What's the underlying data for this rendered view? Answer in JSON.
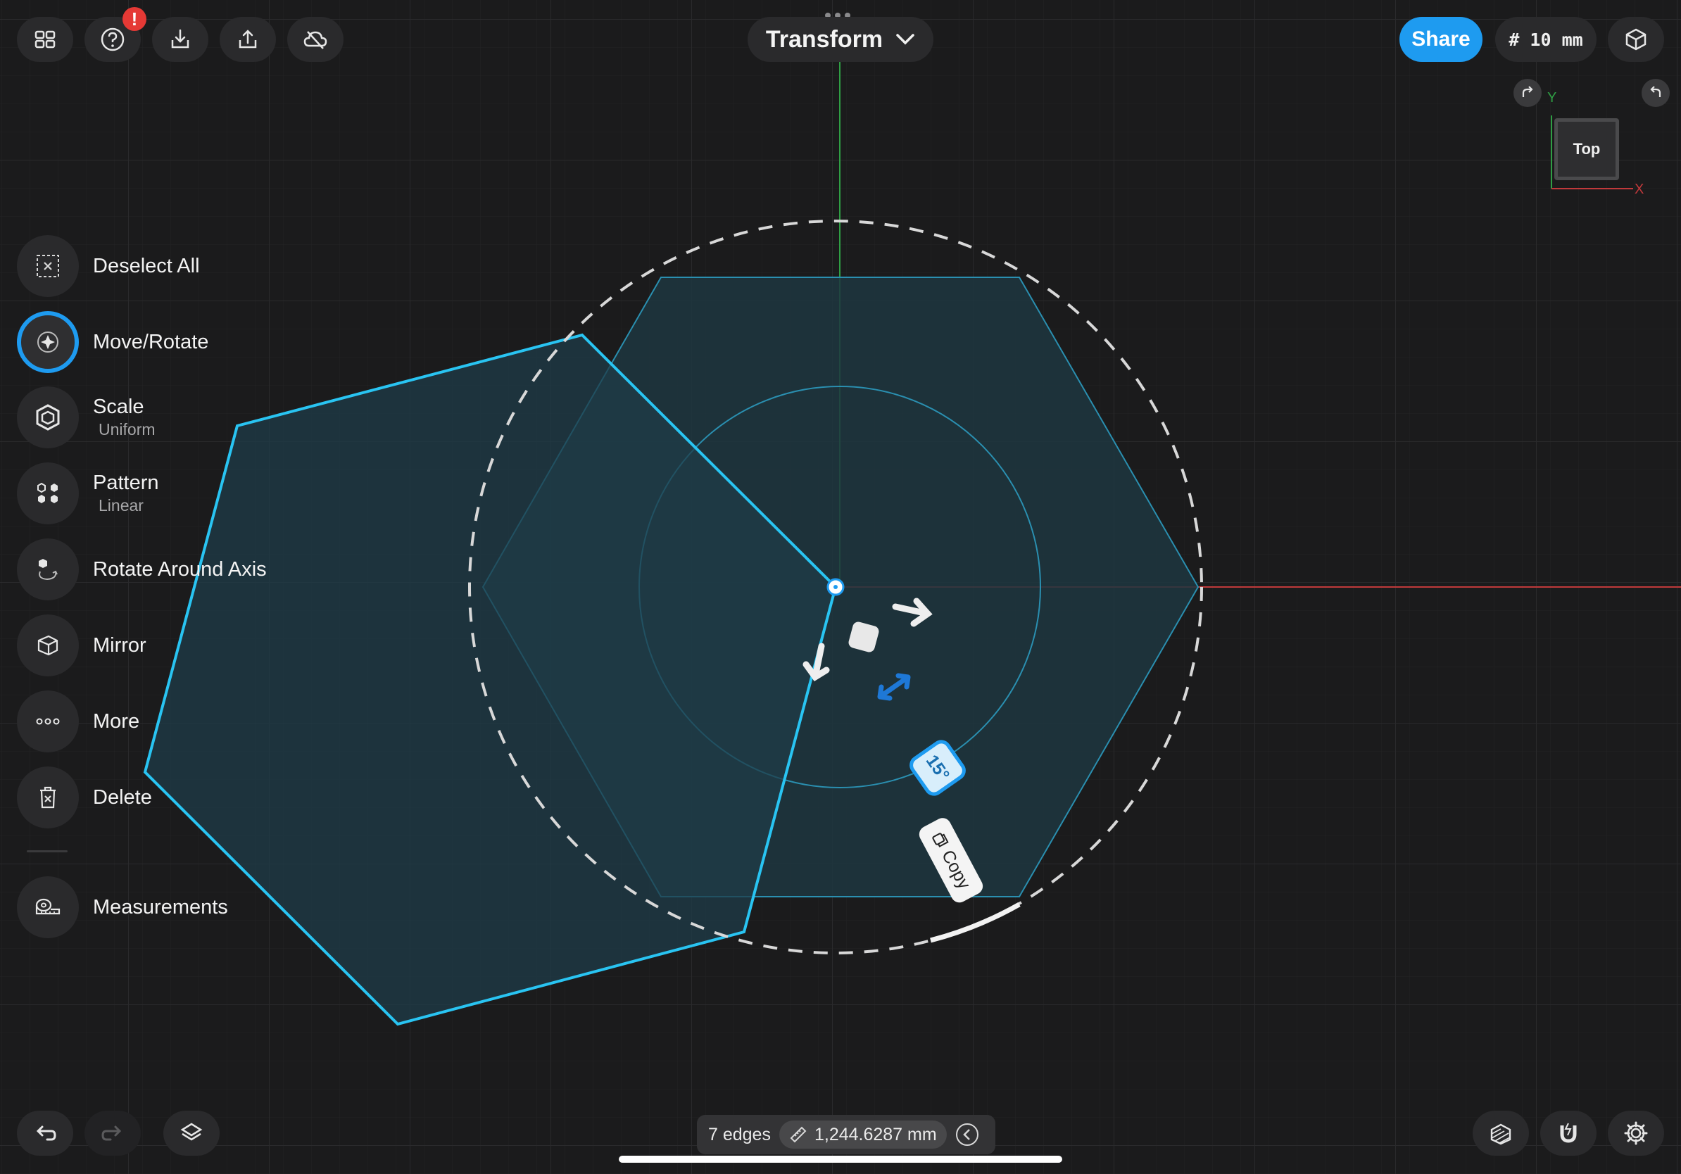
{
  "header": {
    "title": "Transform",
    "share_label": "Share",
    "grid_label": "# 10 mm",
    "notification_badge": "!"
  },
  "toolbar_icons": [
    "grid-icon",
    "help-icon",
    "import-icon",
    "export-icon",
    "cloud-off-icon"
  ],
  "tools": [
    {
      "label": "Deselect All",
      "sub": "",
      "icon": "deselect-icon"
    },
    {
      "label": "Move/Rotate",
      "sub": "",
      "icon": "move-rotate-icon",
      "active": true
    },
    {
      "label": "Scale",
      "sub": "Uniform",
      "icon": "scale-icon"
    },
    {
      "label": "Pattern",
      "sub": "Linear",
      "icon": "pattern-icon"
    },
    {
      "label": "Rotate Around Axis",
      "sub": "",
      "icon": "rotate-axis-icon"
    },
    {
      "label": "Mirror",
      "sub": "",
      "icon": "mirror-icon"
    },
    {
      "label": "More",
      "sub": "",
      "icon": "more-icon"
    },
    {
      "label": "Delete",
      "sub": "",
      "icon": "trash-icon"
    },
    {
      "label": "Measurements",
      "sub": "",
      "icon": "tape-measure-icon"
    }
  ],
  "viewcube": {
    "face_label": "Top",
    "axis_y": "Y",
    "axis_x": "X"
  },
  "canvas": {
    "angle_label": "15°",
    "copy_label": "Copy"
  },
  "status": {
    "edges": "7 edges",
    "length": "1,244.6287 mm"
  },
  "colors": {
    "accent": "#1e9bf0",
    "selection": "#29c4f2",
    "axis_x": "#c0393b",
    "axis_y": "#2f9e44",
    "shape_fill": "#1f3a44",
    "background": "#1b1b1c"
  }
}
